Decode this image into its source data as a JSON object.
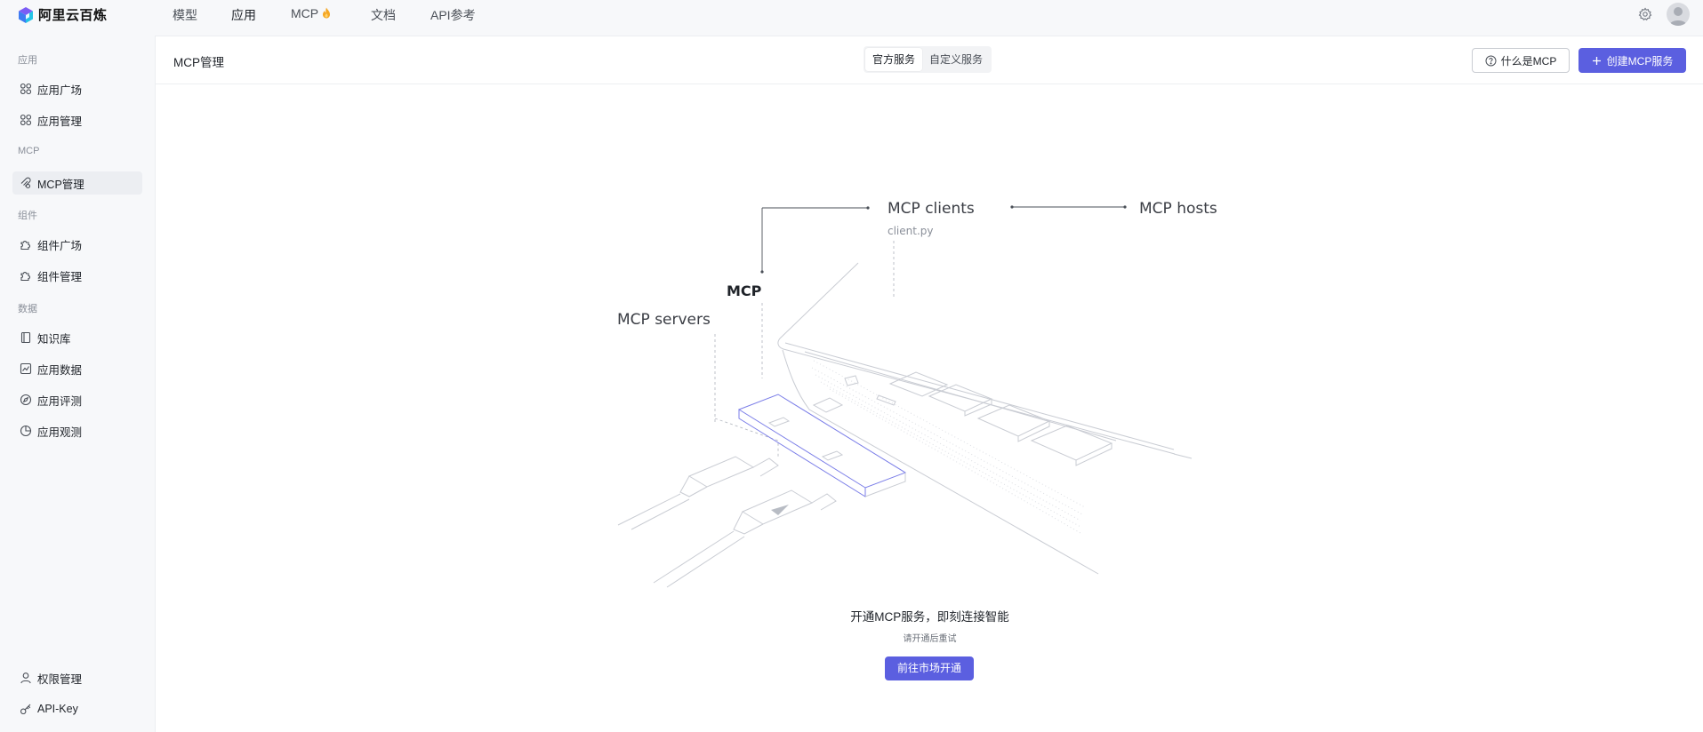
{
  "brand": {
    "name": "阿里云百炼"
  },
  "topnav": {
    "items": [
      {
        "label": "模型"
      },
      {
        "label": "应用"
      },
      {
        "label": "MCP"
      },
      {
        "label": "文档"
      },
      {
        "label": "API参考"
      }
    ],
    "active": "应用"
  },
  "sidebar": {
    "sections": [
      {
        "title": "应用"
      },
      {
        "title": "MCP"
      },
      {
        "title": "组件"
      },
      {
        "title": "数据"
      }
    ],
    "items": [
      {
        "label": "应用广场",
        "icon": "grid-icon"
      },
      {
        "label": "应用管理",
        "icon": "grid-icon"
      },
      {
        "label": "MCP管理",
        "icon": "mcp-icon",
        "active": true
      },
      {
        "label": "组件广场",
        "icon": "puzzle-icon"
      },
      {
        "label": "组件管理",
        "icon": "puzzle-icon"
      },
      {
        "label": "知识库",
        "icon": "book-icon"
      },
      {
        "label": "应用数据",
        "icon": "chart-icon"
      },
      {
        "label": "应用评测",
        "icon": "compass-icon"
      },
      {
        "label": "应用观测",
        "icon": "pie-icon"
      },
      {
        "label": "权限管理",
        "icon": "user-icon"
      },
      {
        "label": "API-Key",
        "icon": "key-icon"
      }
    ]
  },
  "main": {
    "title": "MCP管理",
    "tabs": [
      {
        "label": "官方服务",
        "selected": true
      },
      {
        "label": "自定义服务",
        "selected": false
      }
    ],
    "help_button": "什么是MCP",
    "create_button": "创建MCP服务"
  },
  "illustration": {
    "clients": "MCP clients",
    "client_file": "client.py",
    "hosts": "MCP hosts",
    "mcp": "MCP",
    "servers": "MCP servers"
  },
  "empty_state": {
    "title": "开通MCP服务，即刻连接智能",
    "subtitle": "请开通后重试",
    "button": "前往市场开通"
  },
  "colors": {
    "accent": "#5b5fe0",
    "fire": "#f5a623"
  }
}
